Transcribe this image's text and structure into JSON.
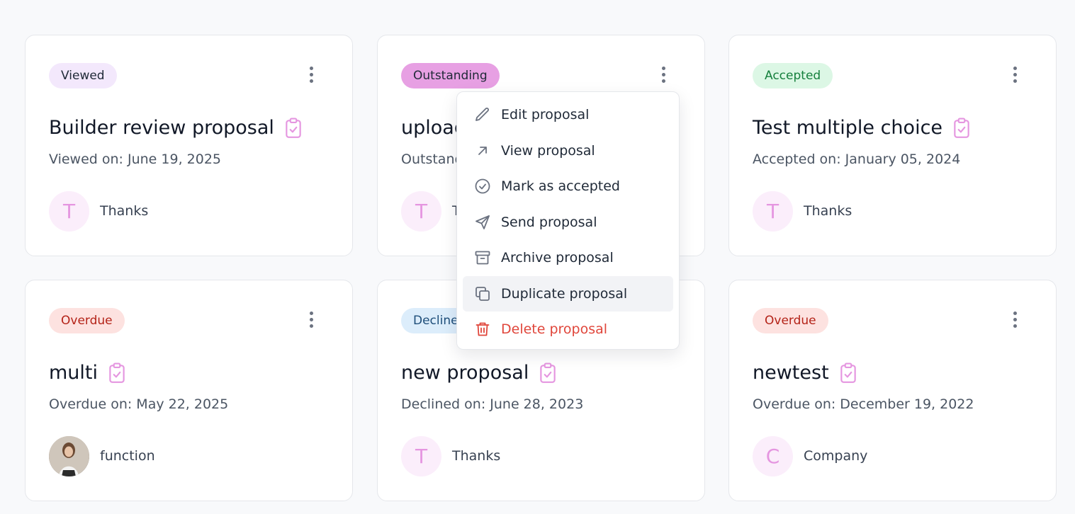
{
  "colors": {
    "clipboard_icon": "#e596e0",
    "avatar_bg": "#fbeefb",
    "danger": "#e0463b"
  },
  "cards": [
    {
      "status": "Viewed",
      "title": "Builder review proposal",
      "date": "Viewed on: June 19, 2025",
      "avatar": "T",
      "client": "Thanks"
    },
    {
      "status": "Outstanding",
      "title": "upload",
      "date": "Outstanding",
      "avatar": "T",
      "client": "T"
    },
    {
      "status": "Accepted",
      "title": "Test multiple choice",
      "date": "Accepted on: January 05, 2024",
      "avatar": "T",
      "client": "Thanks"
    },
    {
      "status": "Overdue",
      "title": "multi",
      "date": "Overdue on: May 22, 2025",
      "avatar": "",
      "client": "function"
    },
    {
      "status": "Decline",
      "title": "new proposal",
      "date": "Declined on: June 28, 2023",
      "avatar": "T",
      "client": "Thanks"
    },
    {
      "status": "Overdue",
      "title": "newtest",
      "date": "Overdue on: December 19, 2022",
      "avatar": "C",
      "client": "Company"
    }
  ],
  "menu": {
    "items": [
      {
        "label": "Edit proposal",
        "icon": "pencil-icon"
      },
      {
        "label": "View proposal",
        "icon": "arrow-up-right-icon"
      },
      {
        "label": "Mark as accepted",
        "icon": "check-circle-icon"
      },
      {
        "label": "Send proposal",
        "icon": "send-icon"
      },
      {
        "label": "Archive proposal",
        "icon": "archive-icon"
      },
      {
        "label": "Duplicate proposal",
        "icon": "duplicate-icon"
      },
      {
        "label": "Delete proposal",
        "icon": "trash-icon"
      }
    ]
  }
}
